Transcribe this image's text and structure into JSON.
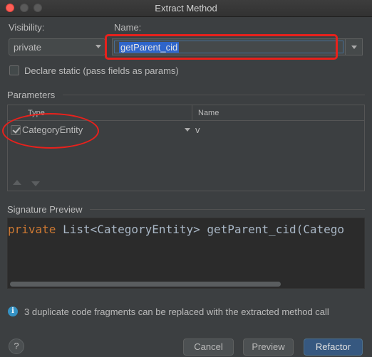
{
  "window": {
    "title": "Extract Method"
  },
  "visibility": {
    "label": "Visibility:",
    "selected": "private"
  },
  "name": {
    "label": "Name:",
    "value": "getParent_cid"
  },
  "declare_static": {
    "label": "Declare static (pass fields as params)",
    "checked": false
  },
  "parameters": {
    "section_label": "Parameters",
    "columns": [
      "Type",
      "Name"
    ],
    "rows": [
      {
        "checked": true,
        "type": "CategoryEntity",
        "name": "v"
      }
    ]
  },
  "signature_preview": {
    "label": "Signature Preview",
    "keyword": "private",
    "rest": " List<CategoryEntity> getParent_cid(Catego"
  },
  "info": {
    "icon": "info-icon",
    "text": "3 duplicate code fragments can be replaced with the extracted method call"
  },
  "buttons": {
    "help": "?",
    "cancel": "Cancel",
    "preview": "Preview",
    "refactor": "Refactor"
  },
  "colors": {
    "accent": "#365880",
    "selection": "#2f65ca",
    "annotation_red": "#e8211c",
    "keyword": "#cc7832"
  }
}
